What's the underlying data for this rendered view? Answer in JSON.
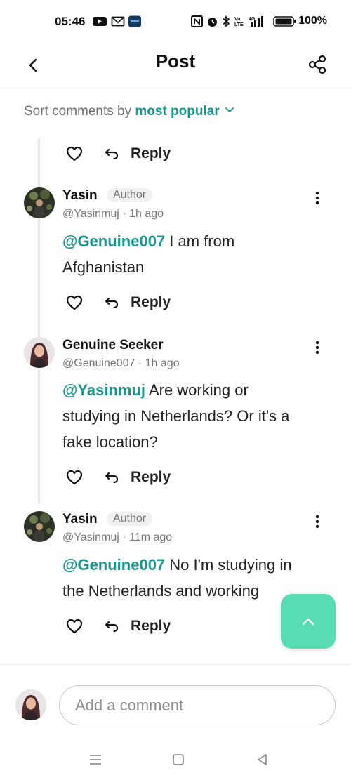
{
  "status_bar": {
    "time": "05:46",
    "battery": "100%",
    "network_label": "4G",
    "volte_label": "Vo LTE"
  },
  "header": {
    "title": "Post",
    "back_icon": "chevron-left-icon",
    "share_icon": "share-icon"
  },
  "sort": {
    "prefix": "Sort comments by",
    "value": "most popular"
  },
  "top_actions": {
    "reply_label": "Reply"
  },
  "comments": [
    {
      "name": "Yasin",
      "badge": "Author",
      "handle": "@Yasinmuj",
      "time": "1h ago",
      "mention": "@Genuine007",
      "body_line1": " I am from",
      "body_line2": "Afghanistan",
      "reply_label": "Reply"
    },
    {
      "name": "Genuine Seeker",
      "handle": "@Genuine007",
      "time": "1h ago",
      "mention": "@Yasinmuj",
      "body_line1": " Are working or",
      "body_line2": "studying in Netherlands? Or it's a",
      "body_line3": "fake location?",
      "reply_label": "Reply"
    },
    {
      "name": "Yasin",
      "badge": "Author",
      "handle": "@Yasinmuj",
      "time": "11m ago",
      "mention": "@Genuine007",
      "body_line1": " No I'm studying in",
      "body_line2": "the Netherlands and working",
      "reply_label": "Reply"
    }
  ],
  "composer": {
    "placeholder": "Add a comment"
  },
  "colors": {
    "accent": "#17988f",
    "fab": "#57dcb3"
  }
}
